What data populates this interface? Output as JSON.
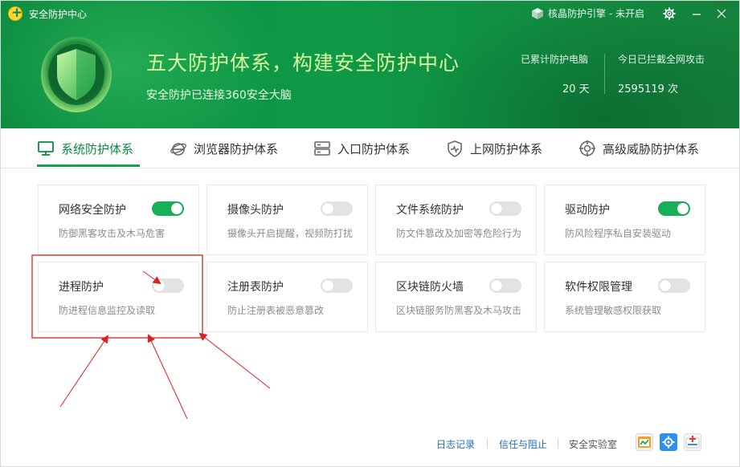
{
  "window": {
    "app_title": "安全防护中心",
    "engine_label": "核晶防护引擎 - 未开启",
    "buttons": {
      "settings": "gear-icon",
      "minimize": "minimize-icon",
      "close": "close-icon"
    }
  },
  "hero": {
    "headline": "五大防护体系，构建安全防护中心",
    "subline": "安全防护已连接360安全大脑",
    "stats": [
      {
        "label": "已累计防护电脑",
        "value": "20 天"
      },
      {
        "label": "今日已拦截全网攻击",
        "value": "2595119 次"
      }
    ]
  },
  "tabs": [
    {
      "label": "系统防护体系",
      "icon": "monitor-icon",
      "active": true
    },
    {
      "label": "浏览器防护体系",
      "icon": "browser-icon",
      "active": false
    },
    {
      "label": "入口防护体系",
      "icon": "server-icon",
      "active": false
    },
    {
      "label": "上网防护体系",
      "icon": "shield-pulse-icon",
      "active": false
    },
    {
      "label": "高级威胁防护体系",
      "icon": "target-icon",
      "active": false
    }
  ],
  "cards": [
    {
      "title": "网络安全防护",
      "desc": "防御黑客攻击及木马危害",
      "enabled": true
    },
    {
      "title": "摄像头防护",
      "desc": "摄像头开启提醒，视频防打扰",
      "enabled": false
    },
    {
      "title": "文件系统防护",
      "desc": "防文件篡改及加密等危险行为",
      "enabled": false
    },
    {
      "title": "驱动防护",
      "desc": "防风险程序私自安装驱动",
      "enabled": true
    },
    {
      "title": "进程防护",
      "desc": "防进程信息监控及读取",
      "enabled": false
    },
    {
      "title": "注册表防护",
      "desc": "防止注册表被恶意篡改",
      "enabled": false
    },
    {
      "title": "区块链防火墙",
      "desc": "区块链服务防黑客及木马攻击",
      "enabled": false
    },
    {
      "title": "软件权限管理",
      "desc": "系统管理敏感权限获取",
      "enabled": false
    }
  ],
  "footer": {
    "log_link": "日志记录",
    "trust_link": "信任与阻止",
    "lab_text": "安全实验室",
    "apps": [
      "chart-app-icon",
      "gear-app-icon",
      "medkit-app-icon"
    ]
  },
  "colors": {
    "brand_green": "#0e9a47",
    "headline_color": "#d8f5a0",
    "toggle_on": "#17b058",
    "toggle_off": "#e3e3e3",
    "link_blue": "#1f6fb6",
    "annotation_red": "#e02020"
  }
}
